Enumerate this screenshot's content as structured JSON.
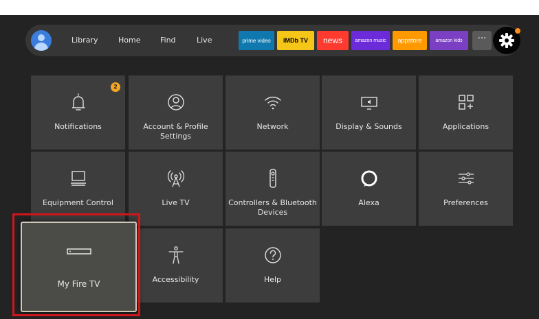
{
  "nav": {
    "links": [
      "Library",
      "Home",
      "Find",
      "Live"
    ],
    "apps": [
      {
        "name": "prime video",
        "bg": "#0f79af"
      },
      {
        "name": "IMDb TV",
        "bg": "#f5c518"
      },
      {
        "name": "news",
        "bg": "#ff3b30"
      },
      {
        "name": "amazon music",
        "bg": "#6c2bd9"
      },
      {
        "name": "appstore",
        "bg": "#ff9900"
      },
      {
        "name": "amazon kids",
        "bg": "#7b3fc4"
      }
    ],
    "more_label": "···"
  },
  "tiles": [
    {
      "label": "Notifications",
      "icon": "bell-icon"
    },
    {
      "label": "Account & Profile Settings",
      "icon": "account-icon"
    },
    {
      "label": "Network",
      "icon": "wifi-icon"
    },
    {
      "label": "Display & Sounds",
      "icon": "display-icon"
    },
    {
      "label": "Applications",
      "icon": "apps-grid-icon"
    },
    {
      "label": "Equipment Control",
      "icon": "equipment-icon"
    },
    {
      "label": "Live TV",
      "icon": "antenna-icon"
    },
    {
      "label": "Controllers & Bluetooth Devices",
      "icon": "remote-icon"
    },
    {
      "label": "Alexa",
      "icon": "alexa-icon"
    },
    {
      "label": "Preferences",
      "icon": "sliders-icon"
    },
    {
      "label": "My Fire TV",
      "icon": "fire-tv-device-icon"
    },
    {
      "label": "Accessibility",
      "icon": "accessibility-icon"
    },
    {
      "label": "Help",
      "icon": "help-icon"
    }
  ],
  "notifications_badge": "2",
  "colors": {
    "highlight": "#d0161b",
    "badge": "#f5a623",
    "background": "#232323",
    "tile": "#3d3d3d"
  }
}
